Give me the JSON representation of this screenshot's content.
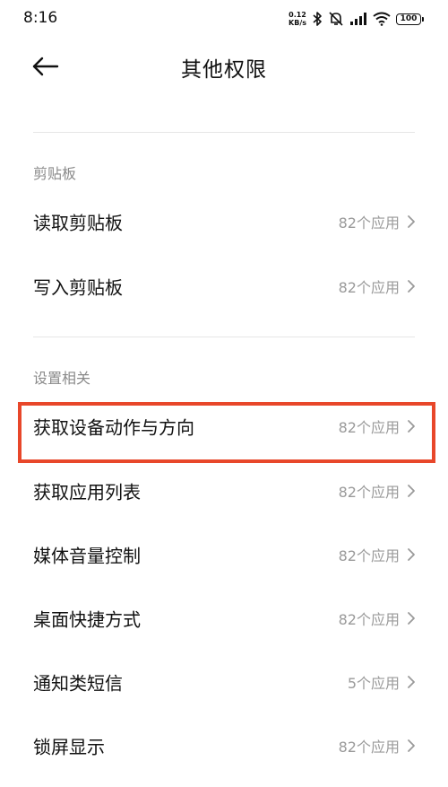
{
  "status_bar": {
    "time": "8:16",
    "net_speed_value": "0.12",
    "net_speed_unit": "KB/s",
    "battery": "100",
    "icons": [
      "bluetooth-icon",
      "mute-icon",
      "signal-icon",
      "wifi-icon",
      "battery-icon"
    ]
  },
  "header": {
    "back_icon": "arrow-left-icon",
    "title": "其他权限"
  },
  "sections": [
    {
      "title": "剪贴板",
      "items": [
        {
          "label": "读取剪贴板",
          "count": "82个应用"
        },
        {
          "label": "写入剪贴板",
          "count": "82个应用"
        }
      ]
    },
    {
      "title": "设置相关",
      "items": [
        {
          "label": "获取设备动作与方向",
          "count": "82个应用"
        },
        {
          "label": "获取应用列表",
          "count": "82个应用"
        },
        {
          "label": "媒体音量控制",
          "count": "82个应用"
        },
        {
          "label": "桌面快捷方式",
          "count": "82个应用"
        },
        {
          "label": "通知类短信",
          "count": "5个应用"
        },
        {
          "label": "锁屏显示",
          "count": "82个应用"
        }
      ]
    }
  ],
  "colors": {
    "highlight_border": "#e8472a",
    "secondary_text": "#9a9a9a",
    "section_text": "#8a8a8a"
  }
}
